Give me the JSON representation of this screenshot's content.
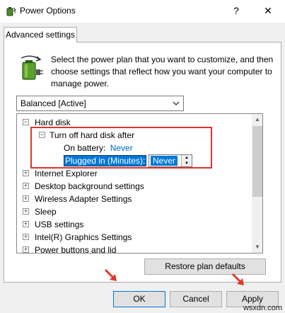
{
  "window": {
    "title": "Power Options",
    "help_glyph": "?",
    "close_glyph": "✕"
  },
  "tab": {
    "label": "Advanced settings"
  },
  "description": "Select the power plan that you want to customize, and then choose settings that reflect how you want your computer to manage power.",
  "plan_select": {
    "value": "Balanced [Active]"
  },
  "tree": {
    "hard_disk": {
      "expander": "−",
      "label": "Hard disk"
    },
    "turn_off": {
      "expander": "−",
      "label": "Turn off hard disk after"
    },
    "on_battery": {
      "label": "On battery:",
      "value": "Never"
    },
    "plugged_in": {
      "label": "Plugged in (Minutes):",
      "value": "Never"
    },
    "items": [
      {
        "expander": "+",
        "label": "Internet Explorer"
      },
      {
        "expander": "+",
        "label": "Desktop background settings"
      },
      {
        "expander": "+",
        "label": "Wireless Adapter Settings"
      },
      {
        "expander": "+",
        "label": "Sleep"
      },
      {
        "expander": "+",
        "label": "USB settings"
      },
      {
        "expander": "+",
        "label": "Intel(R) Graphics Settings"
      },
      {
        "expander": "+",
        "label": "Power buttons and lid"
      }
    ]
  },
  "buttons": {
    "restore": "Restore plan defaults",
    "ok": "OK",
    "cancel": "Cancel",
    "apply": "Apply"
  },
  "watermark": "wsxdn.com",
  "colors": {
    "highlight_border": "#d9362e",
    "selection": "#0078d7",
    "link_value": "#0066cc",
    "arrow": "#e03a2a"
  },
  "icons": {
    "app": "battery-power-icon",
    "large": "battery-power-icon",
    "dropdown": "chevron-down-icon"
  }
}
